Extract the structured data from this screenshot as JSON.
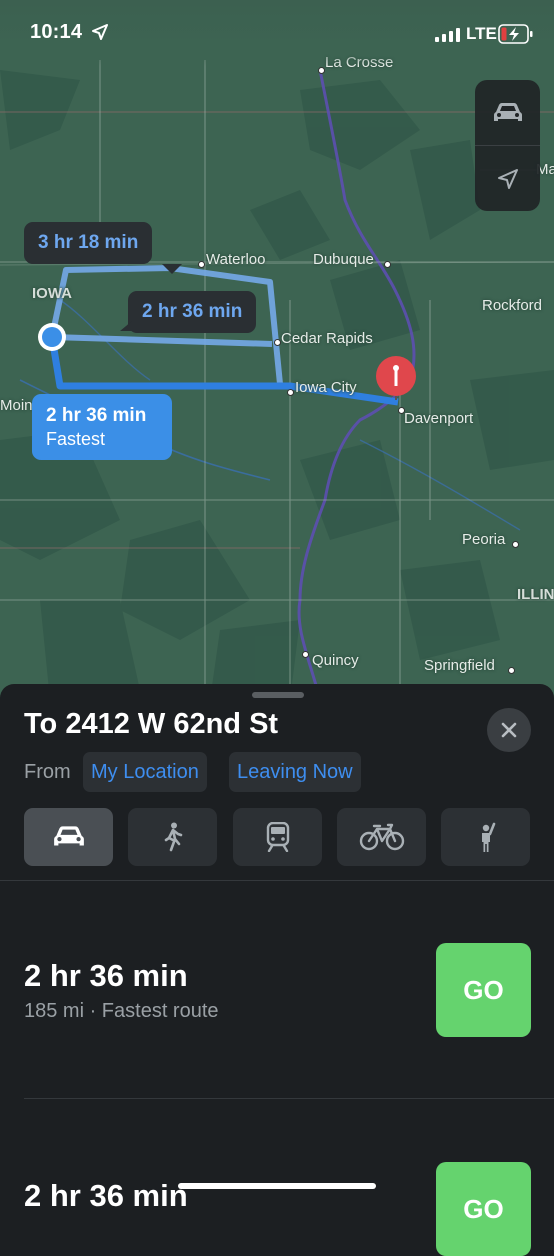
{
  "status": {
    "time": "10:14",
    "network": "LTE",
    "icons": [
      "location-arrow-icon",
      "signal-bars-icon",
      "battery-charging-icon"
    ]
  },
  "map": {
    "labels": {
      "la_crosse": "La Crosse",
      "waterloo": "Waterloo",
      "dubuque": "Dubuque",
      "iowa": "IOWA",
      "rockford": "Rockford",
      "cedar_rapids": "Cedar Rapids",
      "iowa_city": "Iowa City",
      "davenport": "Davenport",
      "des_moines": "Moines",
      "peoria": "Peoria",
      "illinois": "ILLIN",
      "quincy": "Quincy",
      "springfield": "Springfield",
      "ma": "Ma"
    },
    "routes": [
      {
        "time": "3 hr 18 min"
      },
      {
        "time": "2 hr 36 min"
      },
      {
        "time": "2 hr 36 min",
        "note": "Fastest"
      }
    ],
    "controls": [
      "car-icon",
      "location-arrow-icon"
    ],
    "colors": {
      "land": "#3d6452",
      "route": "#3b8fe7",
      "pin": "#e0474c"
    }
  },
  "sheet": {
    "title": "To 2412 W 62nd St",
    "from_label": "From",
    "from_value": "My Location",
    "leaving": "Leaving Now",
    "modes": [
      "car-icon",
      "walk-icon",
      "transit-icon",
      "bike-icon",
      "rideshare-icon"
    ],
    "routes": [
      {
        "time": "2 hr 36 min",
        "details": "185 mi · Fastest route",
        "go": "GO"
      },
      {
        "time": "2 hr 36 min",
        "details": "",
        "go": "GO"
      }
    ]
  }
}
